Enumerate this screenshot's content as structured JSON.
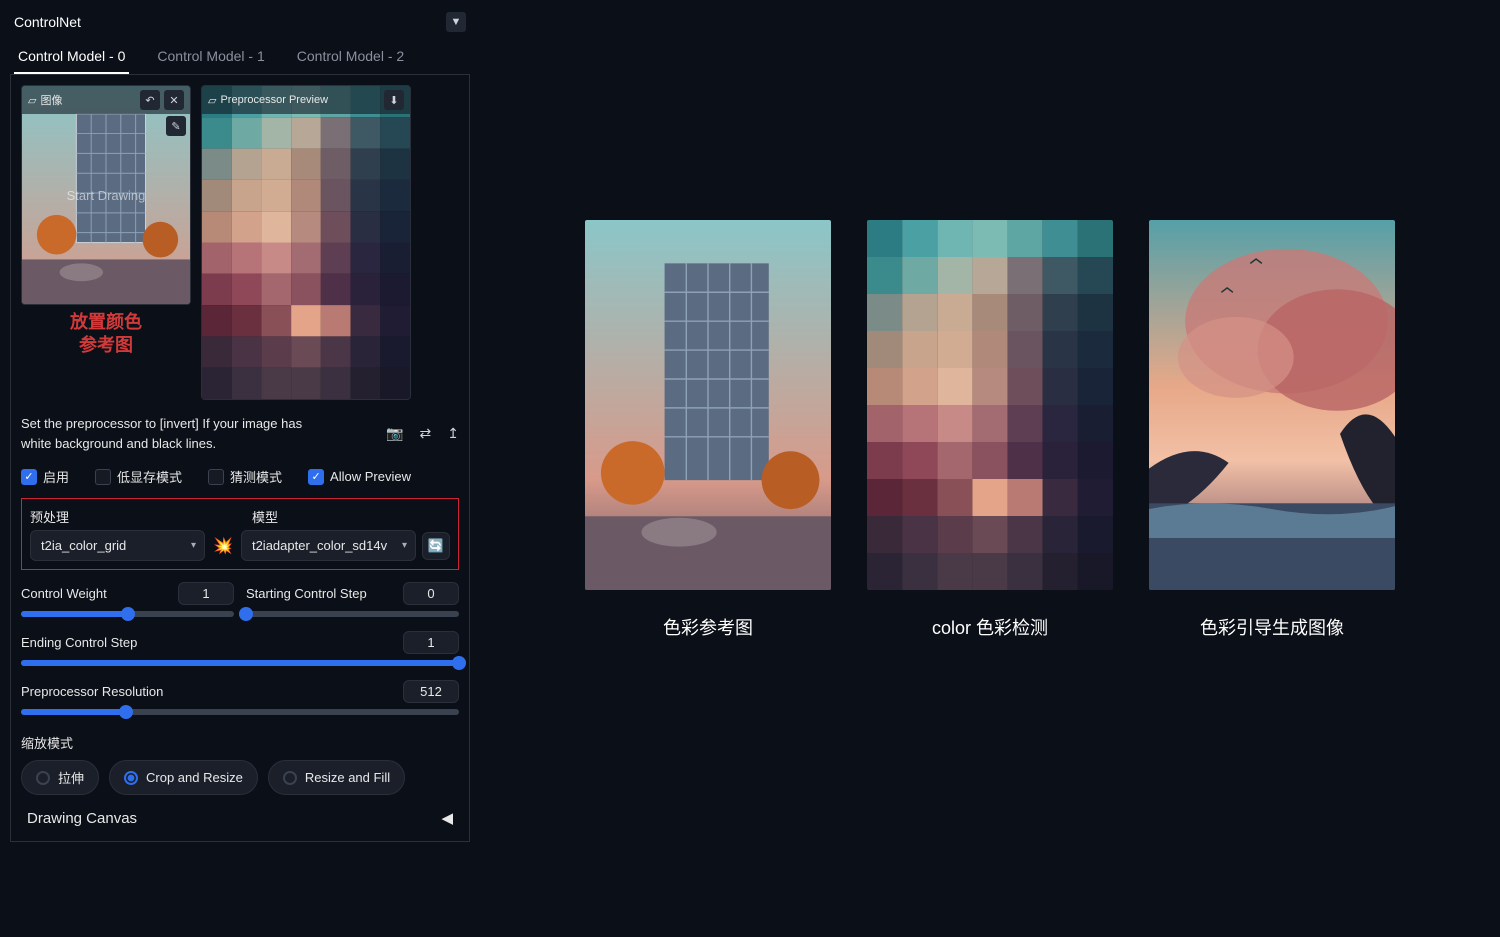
{
  "panel": {
    "title": "ControlNet",
    "tabs": [
      "Control Model - 0",
      "Control Model - 1",
      "Control Model - 2"
    ],
    "image_label": "图像",
    "drawing_overlay": "Start Drawing",
    "preview_label": "Preprocessor Preview",
    "annotation_line1": "放置颜色",
    "annotation_line2": "参考图",
    "hint_text": "Set the preprocessor to [invert] If your image has white background and black lines.",
    "check_enable": "启用",
    "check_lowvram": "低显存模式",
    "check_guess": "猜测模式",
    "check_preview": "Allow Preview",
    "preproc_label": "预处理",
    "model_label": "模型",
    "preproc_value": "t2ia_color_grid",
    "model_value": "t2iadapter_color_sd14v",
    "weight_label": "Control Weight",
    "weight_value": "1",
    "start_label": "Starting Control Step",
    "start_value": "0",
    "end_label": "Ending Control Step",
    "end_value": "1",
    "res_label": "Preprocessor Resolution",
    "res_value": "512",
    "resize_label": "缩放模式",
    "resize_stretch": "拉伸",
    "resize_crop": "Crop and Resize",
    "resize_fill": "Resize and Fill",
    "canvas_label": "Drawing Canvas"
  },
  "showcase": {
    "caption1": "色彩参考图",
    "caption2": "color 色彩检测",
    "caption3": "色彩引导生成图像"
  }
}
